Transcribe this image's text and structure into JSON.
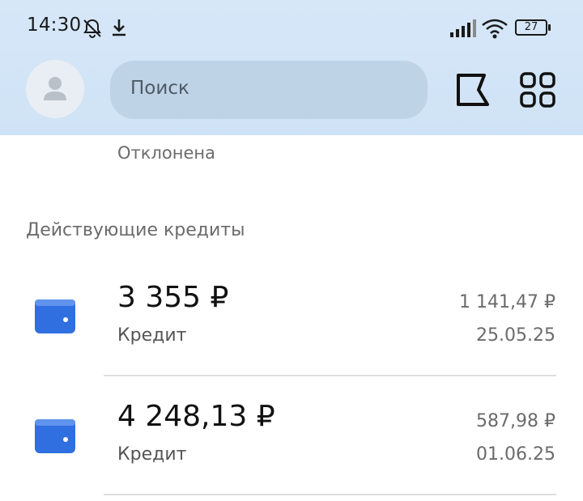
{
  "status_bar": {
    "time": "14:30",
    "battery": "27",
    "icons": [
      "bell-off-icon",
      "download-icon",
      "signal-icon",
      "wifi-icon",
      "battery-icon"
    ]
  },
  "header": {
    "search_placeholder": "Поиск",
    "icons": [
      "avatar-icon",
      "flag-icon",
      "grid-icon"
    ]
  },
  "previous_item_status": "Отклонена",
  "credits": {
    "section_title": "Действующие кредиты",
    "items": [
      {
        "amount": "3 355 ₽",
        "kind": "Кредит",
        "payment": "1 141,47 ₽",
        "date": "25.05.25",
        "icon": "wallet-icon"
      },
      {
        "amount": "4 248,13 ₽",
        "kind": "Кредит",
        "payment": "587,98 ₽",
        "date": "01.06.25",
        "icon": "wallet-icon"
      }
    ]
  },
  "colors": {
    "header_bg": "#d6e7f8",
    "search_bg": "#bfd3e6",
    "wallet_blue": "#2f6fe0"
  }
}
